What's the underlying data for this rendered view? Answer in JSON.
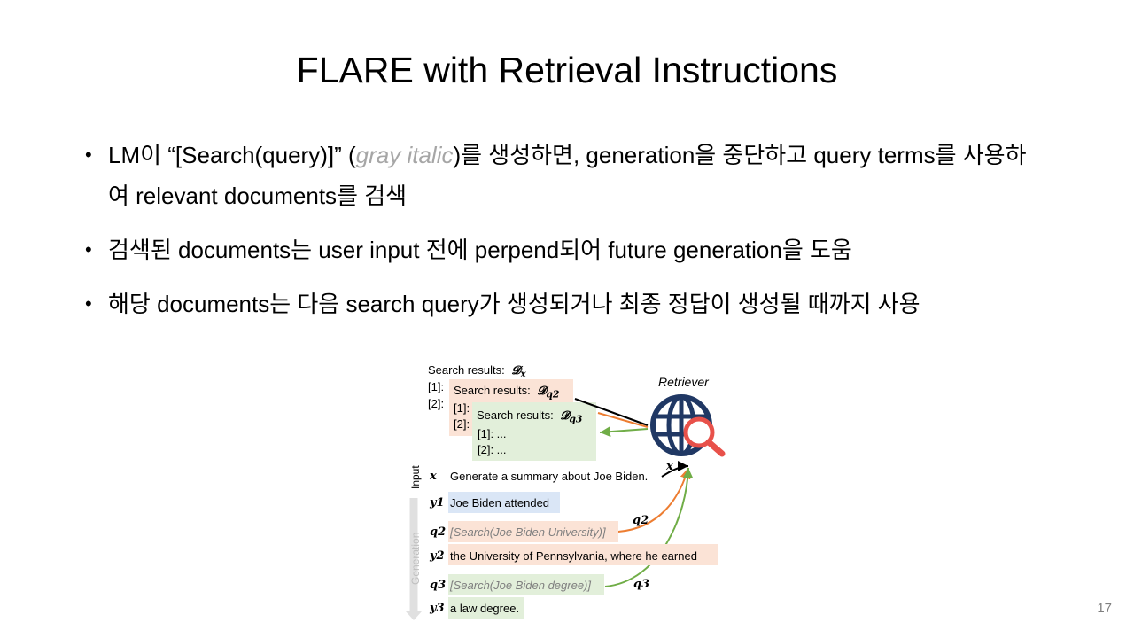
{
  "slide": {
    "title": "FLARE with Retrieval Instructions",
    "page_number": "17",
    "bullet_marker": "•"
  },
  "bullets": [
    {
      "pre": "LM이 “[Search(query)]” (",
      "italic": "gray italic",
      "post": ")를 생성하면, generation을 중단하고 query terms를 사용하여 relevant documents를 검색"
    },
    {
      "text": "검색된 documents는 user input 전에 perpend되어 future generation을 도움"
    },
    {
      "text": "해당 documents는 다음 search query가 생성되거나 최종 정답이 생성될 때까지 사용"
    }
  ],
  "figure": {
    "retriever_label": "Retriever",
    "search_results": [
      {
        "label": "Search results:",
        "symbol": "𝓓",
        "sub": "x",
        "items": [
          "[1]:",
          "[2]:"
        ]
      },
      {
        "label": "Search results:",
        "symbol": "𝓓",
        "sub": "q2",
        "items": [
          "[1]:",
          "[2]:"
        ]
      },
      {
        "label": "Search results:",
        "symbol": "𝓓",
        "sub": "q3",
        "items": [
          "[1]: ...",
          "[2]: ..."
        ]
      }
    ],
    "side_labels": {
      "input": "Input",
      "generation": "Generation"
    },
    "rows": [
      {
        "symbol": "x",
        "text": "Generate a summary about Joe Biden."
      },
      {
        "symbol": "y1",
        "text": "Joe Biden attended"
      },
      {
        "symbol": "q2",
        "text": "[Search(Joe Biden University)]"
      },
      {
        "symbol": "y2",
        "text": "the University of Pennsylvania, where he earned"
      },
      {
        "symbol": "q3",
        "text": "[Search(Joe Biden degree)]"
      },
      {
        "symbol": "y3",
        "text": "a law degree."
      }
    ],
    "arrow_labels": {
      "x": "x",
      "q2": "q2",
      "q3": "q3"
    },
    "colors": {
      "orange_fill": "#fbe3d6",
      "green_fill": "#e2efda",
      "blue_fill": "#dae6f6",
      "orange_arrow": "#ed7d31",
      "green_arrow": "#70ad47",
      "globe": "#203864",
      "magnifier": "#e8514a"
    }
  }
}
